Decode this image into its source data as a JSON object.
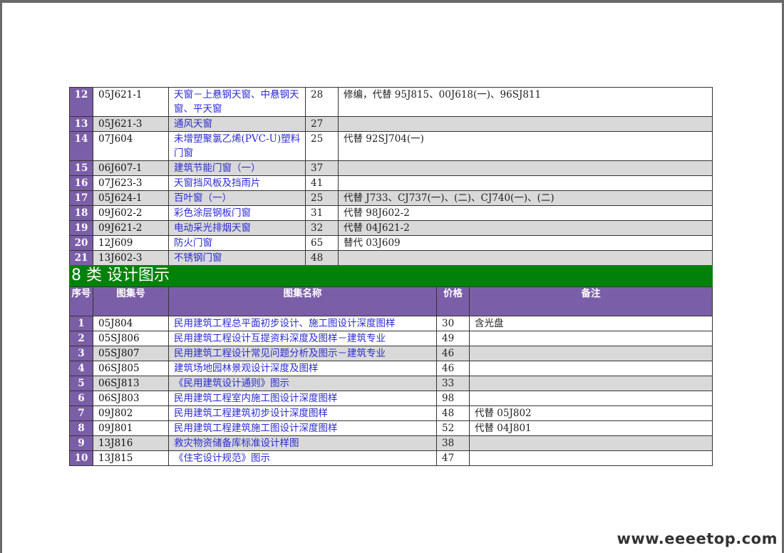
{
  "table_top": {
    "rows": [
      {
        "no": "12",
        "code": "05J621-1",
        "name": "天窗－上悬钢天窗、中悬钢天窗、平天窗",
        "price": "28",
        "remark": "修编，代替 95J815、00J618(一)、96SJ811",
        "alt": false
      },
      {
        "no": "13",
        "code": "05J621-3",
        "name": "通风天窗",
        "price": "27",
        "remark": "",
        "alt": true
      },
      {
        "no": "14",
        "code": "07J604",
        "name": "未增塑聚氯乙烯(PVC-U)塑料门窗",
        "price": "25",
        "remark": "代替 92SJ704(一)",
        "alt": false
      },
      {
        "no": "15",
        "code": "06J607-1",
        "name": "建筑节能门窗（一）",
        "price": "37",
        "remark": "",
        "alt": true
      },
      {
        "no": "16",
        "code": "07J623-3",
        "name": "天窗挡风板及挡雨片",
        "price": "41",
        "remark": "",
        "alt": false
      },
      {
        "no": "17",
        "code": "05J624-1",
        "name": "百叶窗（一）",
        "price": "25",
        "remark": "代替 J733、CJ737(一)、(二)、CJ740(一)、(二)",
        "alt": true
      },
      {
        "no": "18",
        "code": "09J602-2",
        "name": "彩色涂层钢板门窗",
        "price": "31",
        "remark": "代替 98J602-2",
        "alt": false
      },
      {
        "no": "19",
        "code": "09J621-2",
        "name": "电动采光排烟天窗",
        "price": "32",
        "remark": "代替 04J621-2",
        "alt": true
      },
      {
        "no": "20",
        "code": "12J609",
        "name": "防火门窗",
        "price": "65",
        "remark": "替代 03J609",
        "alt": false
      },
      {
        "no": "21",
        "code": "13J602-3",
        "name": "不锈钢门窗",
        "price": "48",
        "remark": "",
        "alt": true
      }
    ]
  },
  "section": {
    "title": "8 类  设计图示"
  },
  "table_bottom": {
    "headers": {
      "no": "序号",
      "code": "图集号",
      "name": "图集名称",
      "price": "价格",
      "remark": "备注"
    },
    "rows": [
      {
        "no": "1",
        "code": "05J804",
        "name": "民用建筑工程总平面初步设计、施工图设计深度图样",
        "price": "30",
        "remark": "含光盘",
        "alt": false
      },
      {
        "no": "2",
        "code": "05SJ806",
        "name": "民用建筑工程设计互提资料深度及图样－建筑专业",
        "price": "49",
        "remark": "",
        "alt": false
      },
      {
        "no": "3",
        "code": "05SJ807",
        "name": "民用建筑工程设计常见问题分析及图示－建筑专业",
        "price": "46",
        "remark": "",
        "alt": true
      },
      {
        "no": "4",
        "code": "06SJ805",
        "name": "建筑场地园林景观设计深度及图样",
        "price": "46",
        "remark": "",
        "alt": false
      },
      {
        "no": "5",
        "code": "06SJ813",
        "name": "《民用建筑设计通则》图示",
        "price": "33",
        "remark": "",
        "alt": true
      },
      {
        "no": "6",
        "code": "06SJ803",
        "name": "民用建筑工程室内施工图设计深度图样",
        "price": "98",
        "remark": "",
        "alt": false
      },
      {
        "no": "7",
        "code": "09J802",
        "name": "民用建筑工程建筑初步设计深度图样",
        "price": "48",
        "remark": "代替 05J802",
        "alt": false
      },
      {
        "no": "8",
        "code": "09J801",
        "name": "民用建筑工程建筑施工图设计深度图样",
        "price": "52",
        "remark": "代替 04J801",
        "alt": false
      },
      {
        "no": "9",
        "code": "13J816",
        "name": "救灾物资储备库标准设计样图",
        "price": "38",
        "remark": "",
        "alt": true
      },
      {
        "no": "10",
        "code": "13J815",
        "name": "《住宅设计规范》图示",
        "price": "47",
        "remark": "",
        "alt": false
      }
    ]
  },
  "watermark": "www.eeeetop.com"
}
